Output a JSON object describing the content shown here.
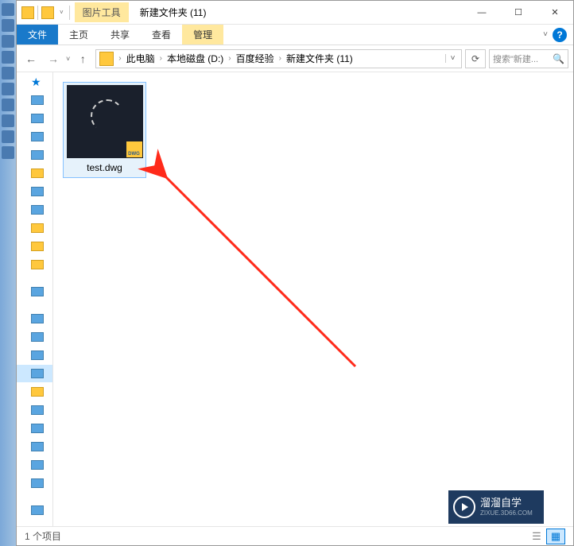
{
  "title": "新建文件夹 (11)",
  "contextual_tab": "图片工具",
  "ribbon": {
    "file": "文件",
    "home": "主页",
    "share": "共享",
    "view": "查看",
    "manage": "管理"
  },
  "breadcrumb": {
    "segments": [
      "此电脑",
      "本地磁盘 (D:)",
      "百度经验",
      "新建文件夹 (11)"
    ]
  },
  "search": {
    "placeholder": "搜索\"新建..."
  },
  "file": {
    "name": "test.dwg",
    "badge": "DWG"
  },
  "status": {
    "count": "1 个项目"
  },
  "watermark": {
    "title": "溜溜自学",
    "sub": "ZIXUE.3D66.COM"
  },
  "icons": {
    "back": "←",
    "forward": "→",
    "up": "↑",
    "refresh": "⟳",
    "search": "🔍",
    "min": "—",
    "max": "☐",
    "close": "✕",
    "chevdown": "˅",
    "star": "★",
    "list": "☰",
    "grid": "▦",
    "help": "?"
  }
}
